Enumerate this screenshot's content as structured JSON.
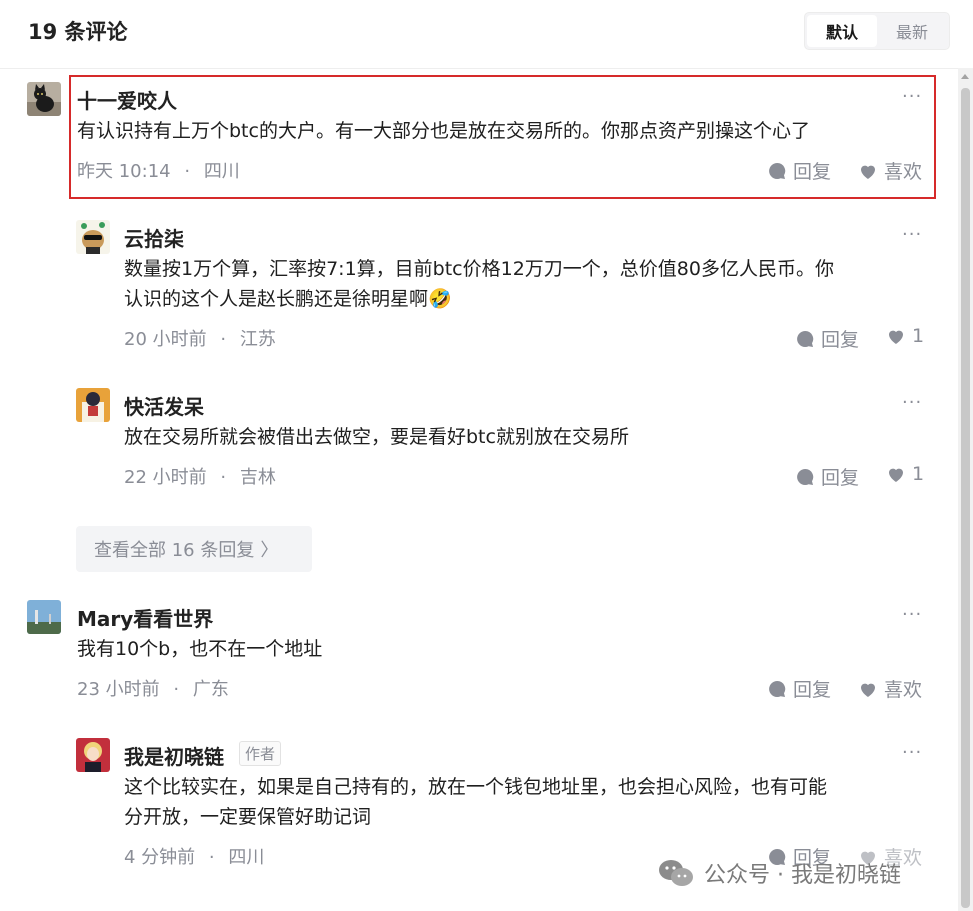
{
  "header": {
    "title": "19 条评论",
    "sort": {
      "default_label": "默认",
      "latest_label": "最新",
      "active": "默认"
    }
  },
  "comments": [
    {
      "name": "十一爱咬人",
      "text": "有认识持有上万个btc的大户。有一大部分也是放在交易所的。你那点资产别操这个心了",
      "time": "昨天 10:14",
      "location": "四川",
      "reply_label": "回复",
      "like_label": "喜欢",
      "highlighted": true,
      "replies": [
        {
          "name": "云拾柒",
          "text_line1": "数量按1万个算，汇率按7:1算，目前btc价格12万刀一个，总价值80多亿人民币。你",
          "text_line2": "认识的这个人是赵长鹏还是徐明星啊",
          "emoji": "🤣",
          "time": "20 小时前",
          "location": "江苏",
          "reply_label": "回复",
          "like_count": "1"
        },
        {
          "name": "快活发呆",
          "text": "放在交易所就会被借出去做空，要是看好btc就别放在交易所",
          "time": "22 小时前",
          "location": "吉林",
          "reply_label": "回复",
          "like_count": "1"
        }
      ],
      "view_all_label": "查看全部 16 条回复",
      "view_all_arrow": "〉"
    },
    {
      "name": "Mary看看世界",
      "text": "我有10个b，也不在一个地址",
      "time": "23 小时前",
      "location": "广东",
      "reply_label": "回复",
      "like_label": "喜欢",
      "replies": [
        {
          "name": "我是初晓链",
          "author_tag": "作者",
          "text_line1": "这个比较实在，如果是自己持有的，放在一个钱包地址里，也会担心风险，也有可能",
          "text_line2": "分开放，一定要保管好助记词",
          "time": "4 分钟前",
          "location": "四川",
          "reply_label": "回复",
          "like_label": "喜欢"
        }
      ]
    }
  ],
  "separator": "·",
  "more_glyph": "···",
  "watermark": {
    "text": "公众号 · 我是初晓链",
    "icon": "wechat-icon"
  },
  "colors": {
    "highlight": "#d62a2a",
    "muted": "#8a8d96",
    "text": "#1f1f1f"
  }
}
